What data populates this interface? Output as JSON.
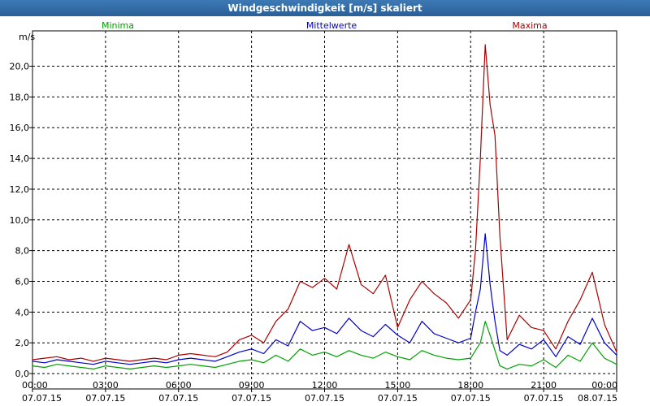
{
  "window": {
    "title": "Windgeschwindigkeit [m/s] skaliert"
  },
  "colors": {
    "titlebar": "#2f6aa4",
    "minima": "#00a000",
    "mittelwerte": "#0000cc",
    "maxima": "#aa0000",
    "grid": "#000000"
  },
  "chart_data": {
    "type": "line",
    "title": "Windgeschwindigkeit [m/s] skaliert",
    "ylabel": "m/s",
    "xlabel": "",
    "ylim": [
      -1.0,
      22.3
    ],
    "xlim": [
      0,
      24
    ],
    "grid": true,
    "legend_position": "top",
    "yticks": [
      0,
      2,
      4,
      6,
      8,
      10,
      12,
      14,
      16,
      18,
      20
    ],
    "ytick_labels": [
      "0,0",
      "2,0",
      "4,0",
      "6,0",
      "8,0",
      "10,0",
      "12,0",
      "14,0",
      "16,0",
      "18,0",
      "20,0"
    ],
    "xticks": [
      {
        "time": "00:00",
        "date": "07.07.15",
        "hours": 0
      },
      {
        "time": "03:00",
        "date": "07.07.15",
        "hours": 3
      },
      {
        "time": "06:00",
        "date": "07.07.15",
        "hours": 6
      },
      {
        "time": "09:00",
        "date": "07.07.15",
        "hours": 9
      },
      {
        "time": "12:00",
        "date": "07.07.15",
        "hours": 12
      },
      {
        "time": "15:00",
        "date": "07.07.15",
        "hours": 15
      },
      {
        "time": "18:00",
        "date": "07.07.15",
        "hours": 18
      },
      {
        "time": "21:00",
        "date": "07.07.15",
        "hours": 21
      },
      {
        "time": "00:00",
        "date": "08.07.15",
        "hours": 24
      }
    ],
    "x": [
      0,
      0.5,
      1,
      1.5,
      2,
      2.5,
      3,
      3.5,
      4,
      4.5,
      5,
      5.5,
      6,
      6.5,
      7,
      7.5,
      8,
      8.5,
      9,
      9.5,
      10,
      10.5,
      11,
      11.5,
      12,
      12.5,
      13,
      13.5,
      14,
      14.5,
      15,
      15.5,
      16,
      16.5,
      17,
      17.5,
      18,
      18.2,
      18.4,
      18.6,
      18.8,
      19,
      19.2,
      19.5,
      20,
      20.5,
      21,
      21.5,
      22,
      22.5,
      23,
      23.5,
      24
    ],
    "series": [
      {
        "name": "Minima",
        "color": "#00a000",
        "values": [
          0.5,
          0.4,
          0.6,
          0.5,
          0.4,
          0.3,
          0.5,
          0.4,
          0.3,
          0.4,
          0.5,
          0.4,
          0.5,
          0.6,
          0.5,
          0.4,
          0.6,
          0.8,
          0.9,
          0.7,
          1.2,
          0.8,
          1.6,
          1.2,
          1.4,
          1.1,
          1.5,
          1.2,
          1.0,
          1.4,
          1.1,
          0.9,
          1.5,
          1.2,
          1.0,
          0.9,
          1.0,
          1.5,
          2.0,
          3.4,
          2.5,
          1.5,
          0.5,
          0.3,
          0.6,
          0.5,
          0.9,
          0.4,
          1.2,
          0.8,
          2.0,
          1.0,
          0.6
        ]
      },
      {
        "name": "Mittelwerte",
        "color": "#0000cc",
        "values": [
          0.8,
          0.7,
          0.9,
          0.8,
          0.7,
          0.6,
          0.8,
          0.7,
          0.6,
          0.7,
          0.8,
          0.7,
          0.9,
          1.0,
          0.9,
          0.8,
          1.1,
          1.4,
          1.6,
          1.3,
          2.2,
          1.8,
          3.4,
          2.8,
          3.0,
          2.6,
          3.6,
          2.8,
          2.4,
          3.2,
          2.5,
          2.0,
          3.4,
          2.6,
          2.3,
          2.0,
          2.3,
          4.0,
          5.5,
          9.1,
          5.8,
          3.4,
          1.5,
          1.2,
          1.9,
          1.6,
          2.2,
          1.1,
          2.4,
          1.9,
          3.6,
          2.0,
          1.2
        ]
      },
      {
        "name": "Maxima",
        "color": "#aa0000",
        "values": [
          0.9,
          1.0,
          1.1,
          0.9,
          1.0,
          0.8,
          1.0,
          0.9,
          0.8,
          0.9,
          1.0,
          0.9,
          1.2,
          1.3,
          1.2,
          1.1,
          1.4,
          2.2,
          2.5,
          2.0,
          3.4,
          4.2,
          6.0,
          5.6,
          6.2,
          5.5,
          8.4,
          5.8,
          5.2,
          6.4,
          3.0,
          4.8,
          6.0,
          5.2,
          4.6,
          3.6,
          4.8,
          8.0,
          14.0,
          21.4,
          17.5,
          15.5,
          9.0,
          2.2,
          3.8,
          3.0,
          2.8,
          1.6,
          3.4,
          4.8,
          6.6,
          3.2,
          1.4
        ]
      }
    ]
  }
}
